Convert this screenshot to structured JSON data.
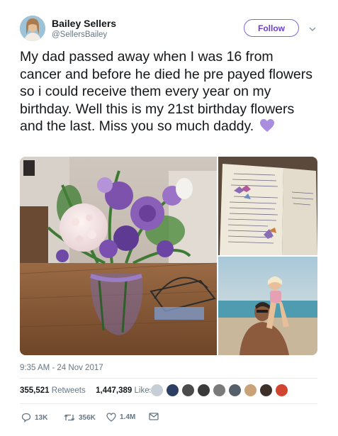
{
  "author": {
    "display_name": "Bailey Sellers",
    "handle": "@SellersBailey"
  },
  "follow_label": "Follow",
  "tweet": {
    "text": "My dad passed away when I was 16 from cancer and before he died he pre payed flowers so i could receive them every year on my birthday. Well this is my 21st birthday flowers and the last. Miss you so much daddy.",
    "emoji_icon": "purple-heart-icon"
  },
  "media": {
    "photos": [
      "flowers-bouquet-photo",
      "handwritten-card-photo",
      "father-daughter-beach-photo"
    ]
  },
  "timestamp": "9:35 AM - 24 Nov 2017",
  "stats": {
    "retweets_count": "355,521",
    "retweets_label": "Retweets",
    "likes_count": "1,447,389",
    "likes_label": "Likes"
  },
  "actions": {
    "reply_count": "13K",
    "retweet_count": "356K",
    "like_count": "1.4M"
  },
  "colors": {
    "follow_accent": "#6a3fc7",
    "heart": "#a98ee0",
    "muted_text": "#657786"
  }
}
